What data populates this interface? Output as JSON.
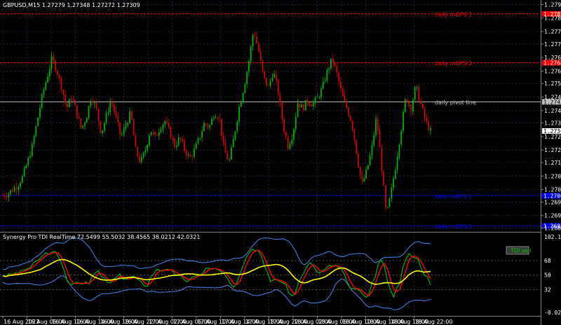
{
  "main": {
    "title": "GBPUSD,M15  1.27279 1.27348 1.27272 1.27309",
    "price_labels": [
      "1.27920",
      "1.27855",
      "1.27790",
      "1.27730",
      "1.27665",
      "1.27600",
      "1.27540",
      "1.27475",
      "1.27410",
      "1.27350",
      "1.27285",
      "1.27220",
      "1.27160",
      "1.27095",
      "1.27030",
      "1.26970",
      "1.26905",
      "1.26845"
    ],
    "lines": [
      {
        "label": "daily mOPS 1",
        "value": 1.27875,
        "color": "#ff0000",
        "tag": "1.27875"
      },
      {
        "label": "daily mOPS 2",
        "value": 1.2764,
        "color": "#ff0000",
        "tag": "1.27640"
      },
      {
        "label": "daily pivot line",
        "value": 1.27452,
        "color": "#c0c0c0",
        "tag": "1.27452"
      },
      {
        "label": "daily mOPS 1",
        "value": 1.27,
        "color": "#0000ff",
        "tag": "1.27000"
      },
      {
        "label": "daily mOPS 2",
        "value": 1.26855,
        "color": "#0000ff",
        "tag": "1.26855"
      }
    ],
    "current_price": "1.27309",
    "candle_colors": {
      "up": "#00b000",
      "down": "#d00000"
    }
  },
  "indicator": {
    "title": "Synergy Pro TDI RealTime 72.5499 55.5032 38.4565 38.0212 42.0321",
    "scale_labels": [
      "102.1232",
      "68",
      "50",
      "32",
      "-0.0217"
    ],
    "button_label": "TDI sell",
    "colors": {
      "bands": "#4a86e8",
      "middle": "#ffff00",
      "green": "#00b000",
      "red": "#ff0000"
    }
  },
  "time_labels": [
    "16 Aug 2023",
    "16 Aug 06:00",
    "16 Aug 10:00",
    "16 Aug 14:00",
    "16 Aug 18:00",
    "16 Aug 22:00",
    "17 Aug 02:00",
    "17 Aug 06:00",
    "17 Aug 10:00",
    "17 Aug 14:00",
    "17 Aug 18:00",
    "17 Aug 22:00",
    "18 Aug 02:00",
    "18 Aug 06:00",
    "18 Aug 10:00",
    "18 Aug 14:00",
    "18 Aug 18:00",
    "18 Aug 22:00"
  ],
  "chart_data": {
    "type": "candlestick",
    "title": "GBPUSD,M15",
    "ylim": [
      1.2683,
      1.27935
    ],
    "closes": [
      1.27,
      1.2701,
      1.2703,
      1.2705,
      1.2709,
      1.2716,
      1.2724,
      1.2736,
      1.2748,
      1.2757,
      1.2766,
      1.276,
      1.2752,
      1.2742,
      1.2748,
      1.274,
      1.2732,
      1.2738,
      1.2748,
      1.2742,
      1.273,
      1.2738,
      1.2746,
      1.2738,
      1.2728,
      1.2734,
      1.274,
      1.2722,
      1.2716,
      1.2722,
      1.2732,
      1.2728,
      1.2733,
      1.2736,
      1.273,
      1.2724,
      1.2728,
      1.2722,
      1.2718,
      1.2722,
      1.2728,
      1.2735,
      1.2733,
      1.274,
      1.2738,
      1.2722,
      1.2716,
      1.2728,
      1.2742,
      1.2752,
      1.2764,
      1.278,
      1.277,
      1.2757,
      1.2752,
      1.276,
      1.275,
      1.2734,
      1.2724,
      1.273,
      1.2745,
      1.2742,
      1.2746,
      1.2744,
      1.2747,
      1.2752,
      1.276,
      1.2766,
      1.2758,
      1.2748,
      1.2742,
      1.2735,
      1.272,
      1.2705,
      1.2712,
      1.2722,
      1.2738,
      1.2715,
      1.269,
      1.2702,
      1.2716,
      1.2732,
      1.2748,
      1.2742,
      1.2753,
      1.2744,
      1.2736,
      1.2731
    ]
  }
}
